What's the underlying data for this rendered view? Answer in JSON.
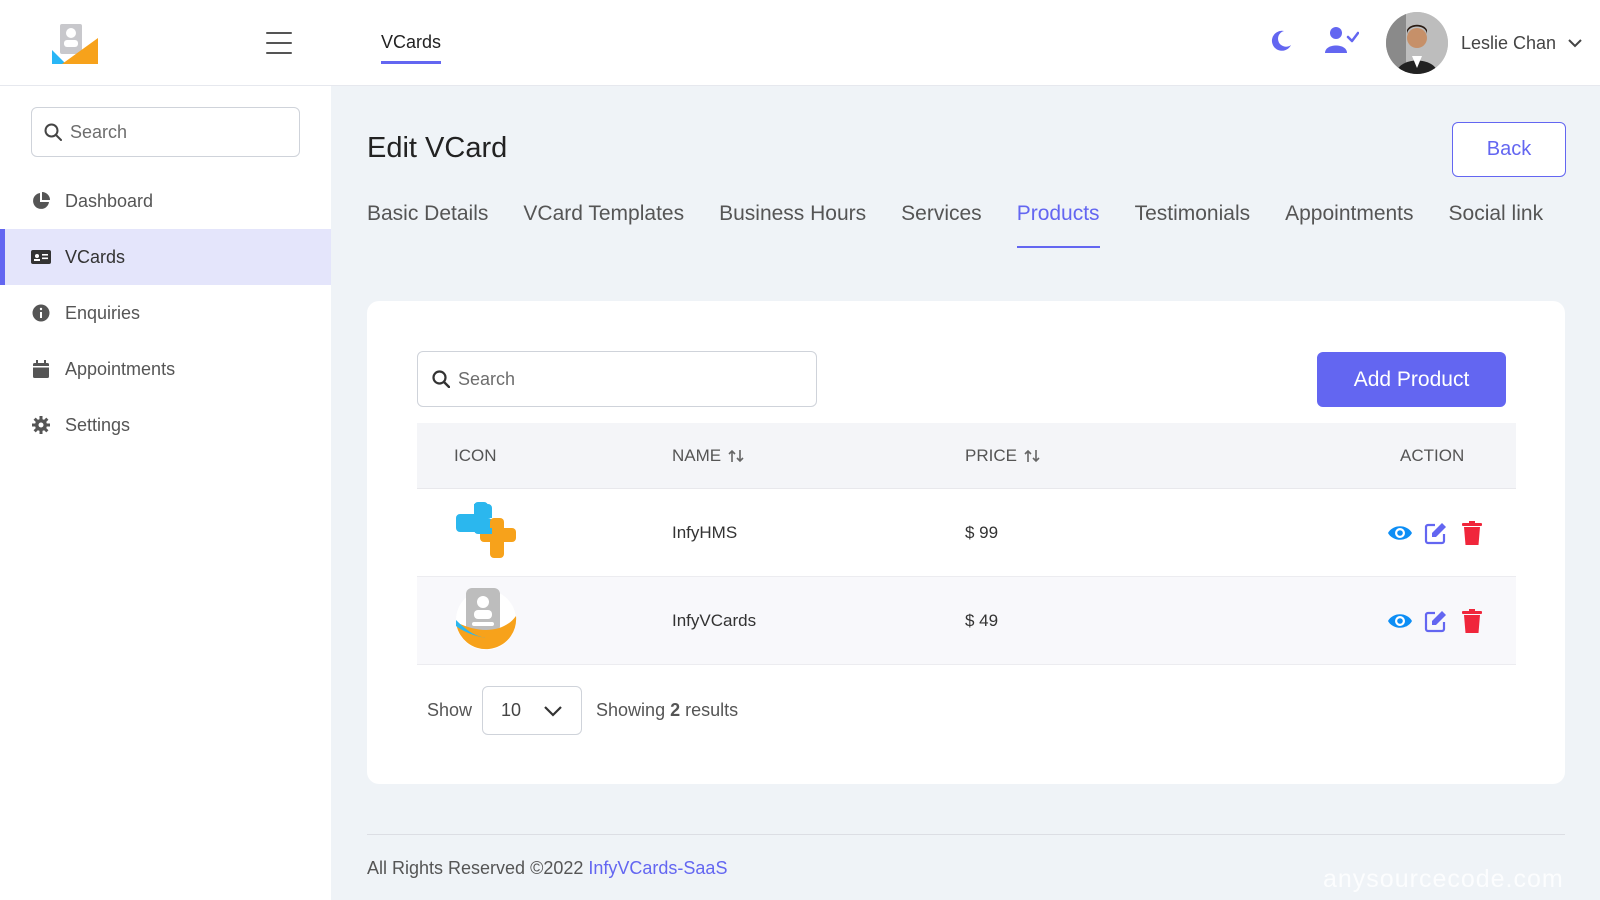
{
  "header": {
    "nav_tab": "VCards",
    "user_name": "Leslie Chan"
  },
  "sidebar": {
    "search_placeholder": "Search",
    "items": [
      {
        "label": "Dashboard",
        "icon": "pie-chart-icon"
      },
      {
        "label": "VCards",
        "icon": "id-card-icon",
        "active": true
      },
      {
        "label": "Enquiries",
        "icon": "info-circle-icon"
      },
      {
        "label": "Appointments",
        "icon": "calendar-icon"
      },
      {
        "label": "Settings",
        "icon": "gear-icon"
      }
    ]
  },
  "main": {
    "title": "Edit VCard",
    "back_label": "Back",
    "tabs": [
      "Basic Details",
      "VCard Templates",
      "Business Hours",
      "Services",
      "Products",
      "Testimonials",
      "Appointments",
      "Social link"
    ],
    "active_tab": "Products"
  },
  "products": {
    "search_placeholder": "Search",
    "add_label": "Add Product",
    "columns": {
      "icon": "ICON",
      "name": "NAME",
      "price": "PRICE",
      "action": "ACTION"
    },
    "rows": [
      {
        "name": "InfyHMS",
        "price": "$ 99",
        "icon": "infyhms-logo"
      },
      {
        "name": "InfyVCards",
        "price": "$ 49",
        "icon": "infyvcards-logo"
      }
    ],
    "show_label": "Show",
    "per_page": "10",
    "showing_prefix": "Showing",
    "showing_count": "2",
    "showing_suffix": "results"
  },
  "footer": {
    "copyright": "All Rights Reserved ©2022",
    "brand_link": "InfyVCards-SaaS",
    "watermark": "anysourcecode.com"
  },
  "colors": {
    "accent": "#6366f1",
    "view": "#0d8ef5",
    "delete": "#f0263b"
  }
}
